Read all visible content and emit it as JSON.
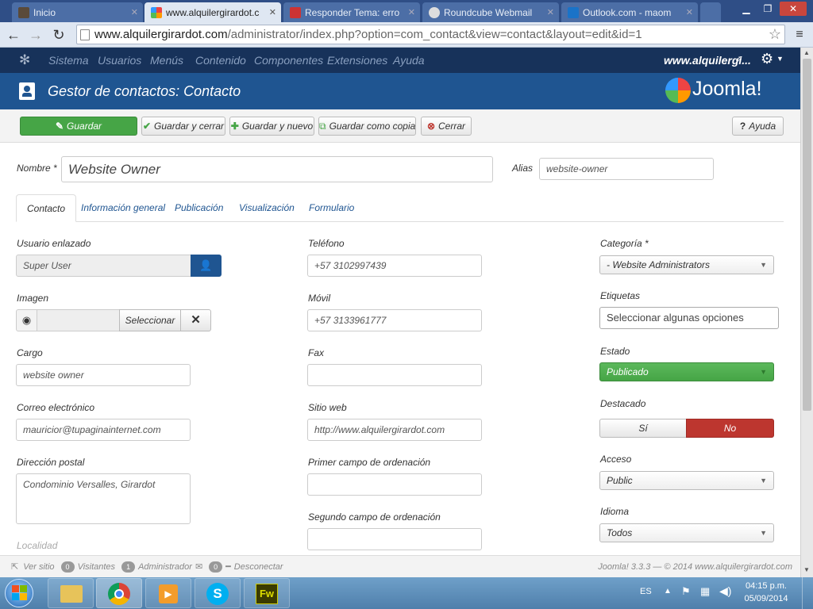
{
  "browser": {
    "tabs": [
      {
        "title": "Inicio",
        "active": false
      },
      {
        "title": "www.alquilergirardot.c",
        "active": true
      },
      {
        "title": "Responder Tema: erro",
        "active": false
      },
      {
        "title": "Roundcube Webmail",
        "active": false
      },
      {
        "title": "Outlook.com - maom",
        "active": false
      }
    ],
    "url_host": "www.alquilergirardot.com",
    "url_path": "/administrator/index.php?option=com_contact&view=contact&layout=edit&id=1"
  },
  "joomla": {
    "menu": [
      "Sistema",
      "Usuarios",
      "Menús",
      "Contenido",
      "Componentes",
      "Extensiones",
      "Ayuda"
    ],
    "site_link": "www.alquilergi...",
    "page_title": "Gestor de contactos: Contacto",
    "logo_text": "Joomla!"
  },
  "toolbar": {
    "save": "Guardar",
    "save_close": "Guardar y cerrar",
    "save_new": "Guardar y nuevo",
    "save_copy": "Guardar como copia",
    "close": "Cerrar",
    "help": "Ayuda"
  },
  "form": {
    "name_label": "Nombre *",
    "name_value": "Website Owner",
    "alias_label": "Alias",
    "alias_value": "website-owner",
    "tabs": [
      "Contacto",
      "Información general",
      "Publicación",
      "Visualización",
      "Formulario"
    ],
    "linked_user_label": "Usuario enlazado",
    "linked_user_value": "Super User",
    "image_label": "Imagen",
    "image_select": "Seleccionar",
    "position_label": "Cargo",
    "position_value": "website owner",
    "email_label": "Correo electrónico",
    "email_value": "mauricior@tupaginainternet.com",
    "address_label": "Dirección postal",
    "address_value": "Condominio Versalles, Girardot",
    "city_label": "Localidad",
    "phone_label": "Teléfono",
    "phone_value": "+57 3102997439",
    "mobile_label": "Móvil",
    "mobile_value": "+57 3133961777",
    "fax_label": "Fax",
    "fax_value": "",
    "website_label": "Sitio web",
    "website_value": "http://www.alquilergirardot.com",
    "sort1_label": "Primer campo de ordenación",
    "sort1_value": "",
    "sort2_label": "Segundo campo de ordenación",
    "sort2_value": "",
    "category_label": "Categoría *",
    "category_value": "- Website Administrators",
    "tags_label": "Etiquetas",
    "tags_placeholder": "Seleccionar algunas opciones",
    "status_label": "Estado",
    "status_value": "Publicado",
    "featured_label": "Destacado",
    "featured_yes": "Sí",
    "featured_no": "No",
    "access_label": "Acceso",
    "access_value": "Public",
    "language_label": "Idioma",
    "language_value": "Todos"
  },
  "statusbar": {
    "view_site": "Ver sitio",
    "visitors_count": "0",
    "visitors": "Visitantes",
    "admin_count": "1",
    "admin": "Administrador",
    "messages_count": "0",
    "logout": "Desconectar",
    "version": "Joomla! 3.3.3 — © 2014 www.alquilergirardot.com"
  },
  "taskbar": {
    "lang": "ES",
    "time": "04:15 p.m.",
    "date": "05/09/2014"
  },
  "colors": {
    "joomla_dark": "#17325a",
    "joomla_header": "#1f5591",
    "green": "#46a546",
    "red": "#bd362f"
  }
}
